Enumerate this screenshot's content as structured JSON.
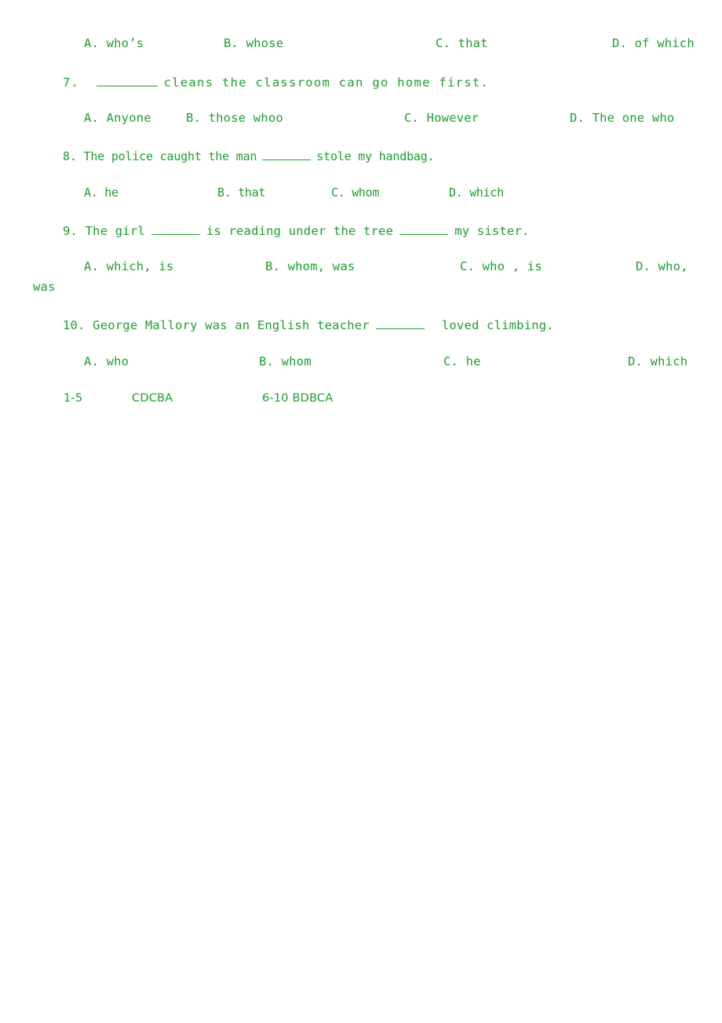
{
  "document": {
    "type": "english-grammar-worksheet",
    "topic": "relative-clauses",
    "text_color": "#1e9e2e",
    "background_color": "#ffffff"
  },
  "options_row_q6": {
    "a": "A. who’s",
    "b": "B. whose",
    "c": "C. that",
    "d": "D. of which"
  },
  "question7": {
    "number": "7.",
    "text_before_blank": "",
    "text_after_blank": "cleans the classroom can go home first.",
    "options": {
      "a": "A. Anyone",
      "b": "B. those whoo",
      "c": "C. However",
      "d": "D. The one who"
    }
  },
  "question8": {
    "number": "8.",
    "text_before_blank": "The police caught the man",
    "text_after_blank": "stole my handbag.",
    "options": {
      "a": "A. he",
      "b": "B. that",
      "c": "C. whom",
      "d": "D. which"
    }
  },
  "question9": {
    "number": "9.",
    "text_part1": "The girl",
    "text_part2": "is reading under the tree",
    "text_part3": "my sister.",
    "options": {
      "a": "A. which, is",
      "b": "B. whom, was",
      "c": "C. who , is",
      "d": "D. who,",
      "d_continuation": "was"
    }
  },
  "question10": {
    "number": "10.",
    "text_before_blank": "George Mallory was an English teacher",
    "text_after_blank": "loved climbing.",
    "options": {
      "a": "A. who",
      "b": "B. whom",
      "c": "C. he",
      "d": "D. which"
    }
  },
  "answer_key": {
    "range1_label": "1-5",
    "range1_answers": "CDCBA",
    "range2": "6-10 BDBCA"
  }
}
